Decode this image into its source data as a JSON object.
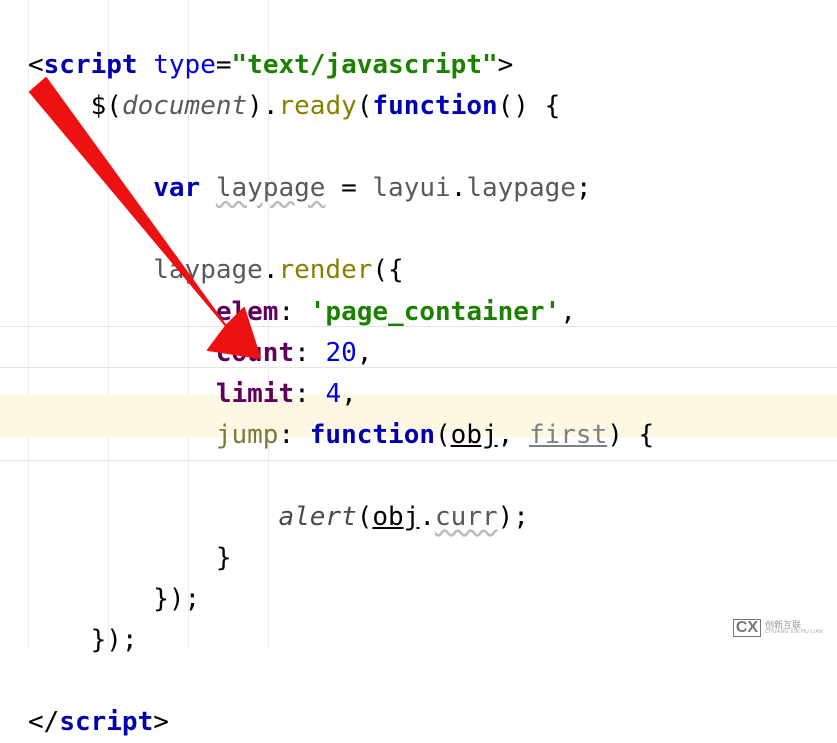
{
  "code": {
    "tag_open": "script",
    "type_attr": "type",
    "type_val": "\"text/javascript\"",
    "jq": "$",
    "document": "document",
    "ready": "ready",
    "function": "function",
    "var": "var",
    "laypage_var": "laypage",
    "eq": " = ",
    "layui": "layui",
    "laypage_prop": "laypage",
    "render": "render",
    "elem": "elem",
    "elem_val": "'page_container'",
    "count": "count",
    "count_val": "20",
    "limit": "limit",
    "limit_val": "4",
    "jump": "jump",
    "obj": "obj",
    "first": "first",
    "alert": "alert",
    "curr": "curr",
    "tag_close": "script"
  },
  "watermark": {
    "logo": "CX",
    "line1": "创新互联",
    "line2": "CHUANG XIN HU LIAN"
  }
}
